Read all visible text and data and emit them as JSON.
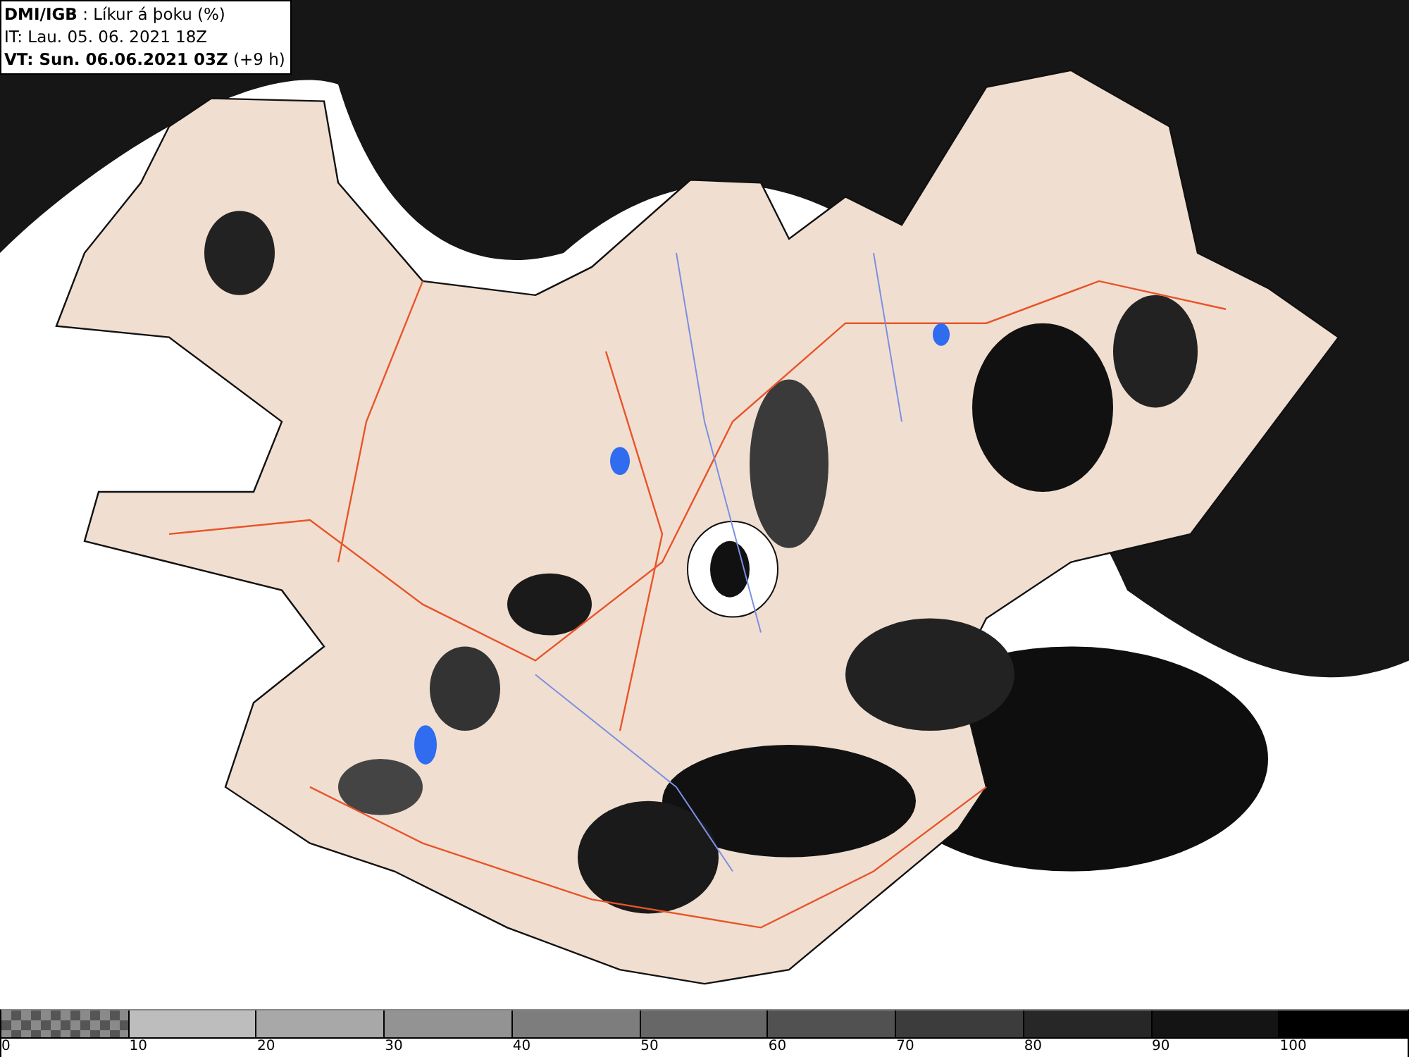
{
  "header": {
    "lines": [
      "**DMI/IGB** : Líkur á þoku (%)",
      "IT: Lau. 05. 06. 2021 18Z",
      "**VT: Sun. 06.06.2021 03Z** (+9 h)"
    ]
  },
  "legend": {
    "bands": [
      {
        "kind": "pattern",
        "color": "#555555"
      },
      {
        "kind": "solid",
        "color": "#bdbdbd"
      },
      {
        "kind": "solid",
        "color": "#a8a8a8"
      },
      {
        "kind": "solid",
        "color": "#939393"
      },
      {
        "kind": "solid",
        "color": "#7d7d7d"
      },
      {
        "kind": "solid",
        "color": "#676767"
      },
      {
        "kind": "solid",
        "color": "#515151"
      },
      {
        "kind": "solid",
        "color": "#3c3c3c"
      },
      {
        "kind": "solid",
        "color": "#272727"
      },
      {
        "kind": "solid",
        "color": "#141414"
      },
      {
        "kind": "solid",
        "color": "#000000"
      }
    ],
    "labels": [
      "0",
      "10",
      "20",
      "30",
      "40",
      "50",
      "60",
      "70",
      "80",
      "90",
      "100"
    ]
  }
}
